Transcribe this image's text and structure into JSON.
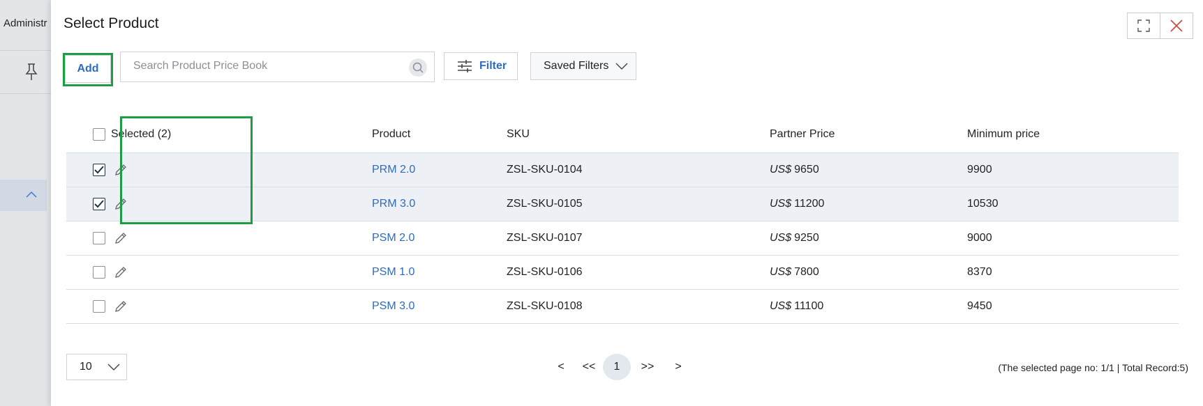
{
  "background": {
    "header_text": "Administr"
  },
  "modal": {
    "title": "Select Product",
    "toolbar": {
      "add_label": "Add",
      "search_placeholder": "Search Product Price Book",
      "filter_label": "Filter",
      "saved_filters_label": "Saved Filters"
    },
    "table": {
      "headers": {
        "selected": "Selected (2)",
        "product": "Product",
        "sku": "SKU",
        "partner_price": "Partner Price",
        "minimum_price": "Minimum price"
      },
      "currency": "US$",
      "rows": [
        {
          "checked": true,
          "product": "PRM 2.0",
          "sku": "ZSL-SKU-0104",
          "partner_price": "9650",
          "minimum_price": "9900"
        },
        {
          "checked": true,
          "product": "PRM 3.0",
          "sku": "ZSL-SKU-0105",
          "partner_price": "11200",
          "minimum_price": "10530"
        },
        {
          "checked": false,
          "product": "PSM 2.0",
          "sku": "ZSL-SKU-0107",
          "partner_price": "9250",
          "minimum_price": "9000"
        },
        {
          "checked": false,
          "product": "PSM 1.0",
          "sku": "ZSL-SKU-0106",
          "partner_price": "7800",
          "minimum_price": "8370"
        },
        {
          "checked": false,
          "product": "PSM 3.0",
          "sku": "ZSL-SKU-0108",
          "partner_price": "11100",
          "minimum_price": "9450"
        }
      ]
    },
    "pagination": {
      "page_size": "10",
      "prev": "<",
      "first": "<<",
      "current_page": "1",
      "last": ">>",
      "next": ">",
      "info": "(The selected page no: 1/1 | Total Record:5)"
    }
  },
  "colors": {
    "accent": "#2d6bc4",
    "highlight": "#1f9d45",
    "selected_row": "#edf1f6"
  }
}
